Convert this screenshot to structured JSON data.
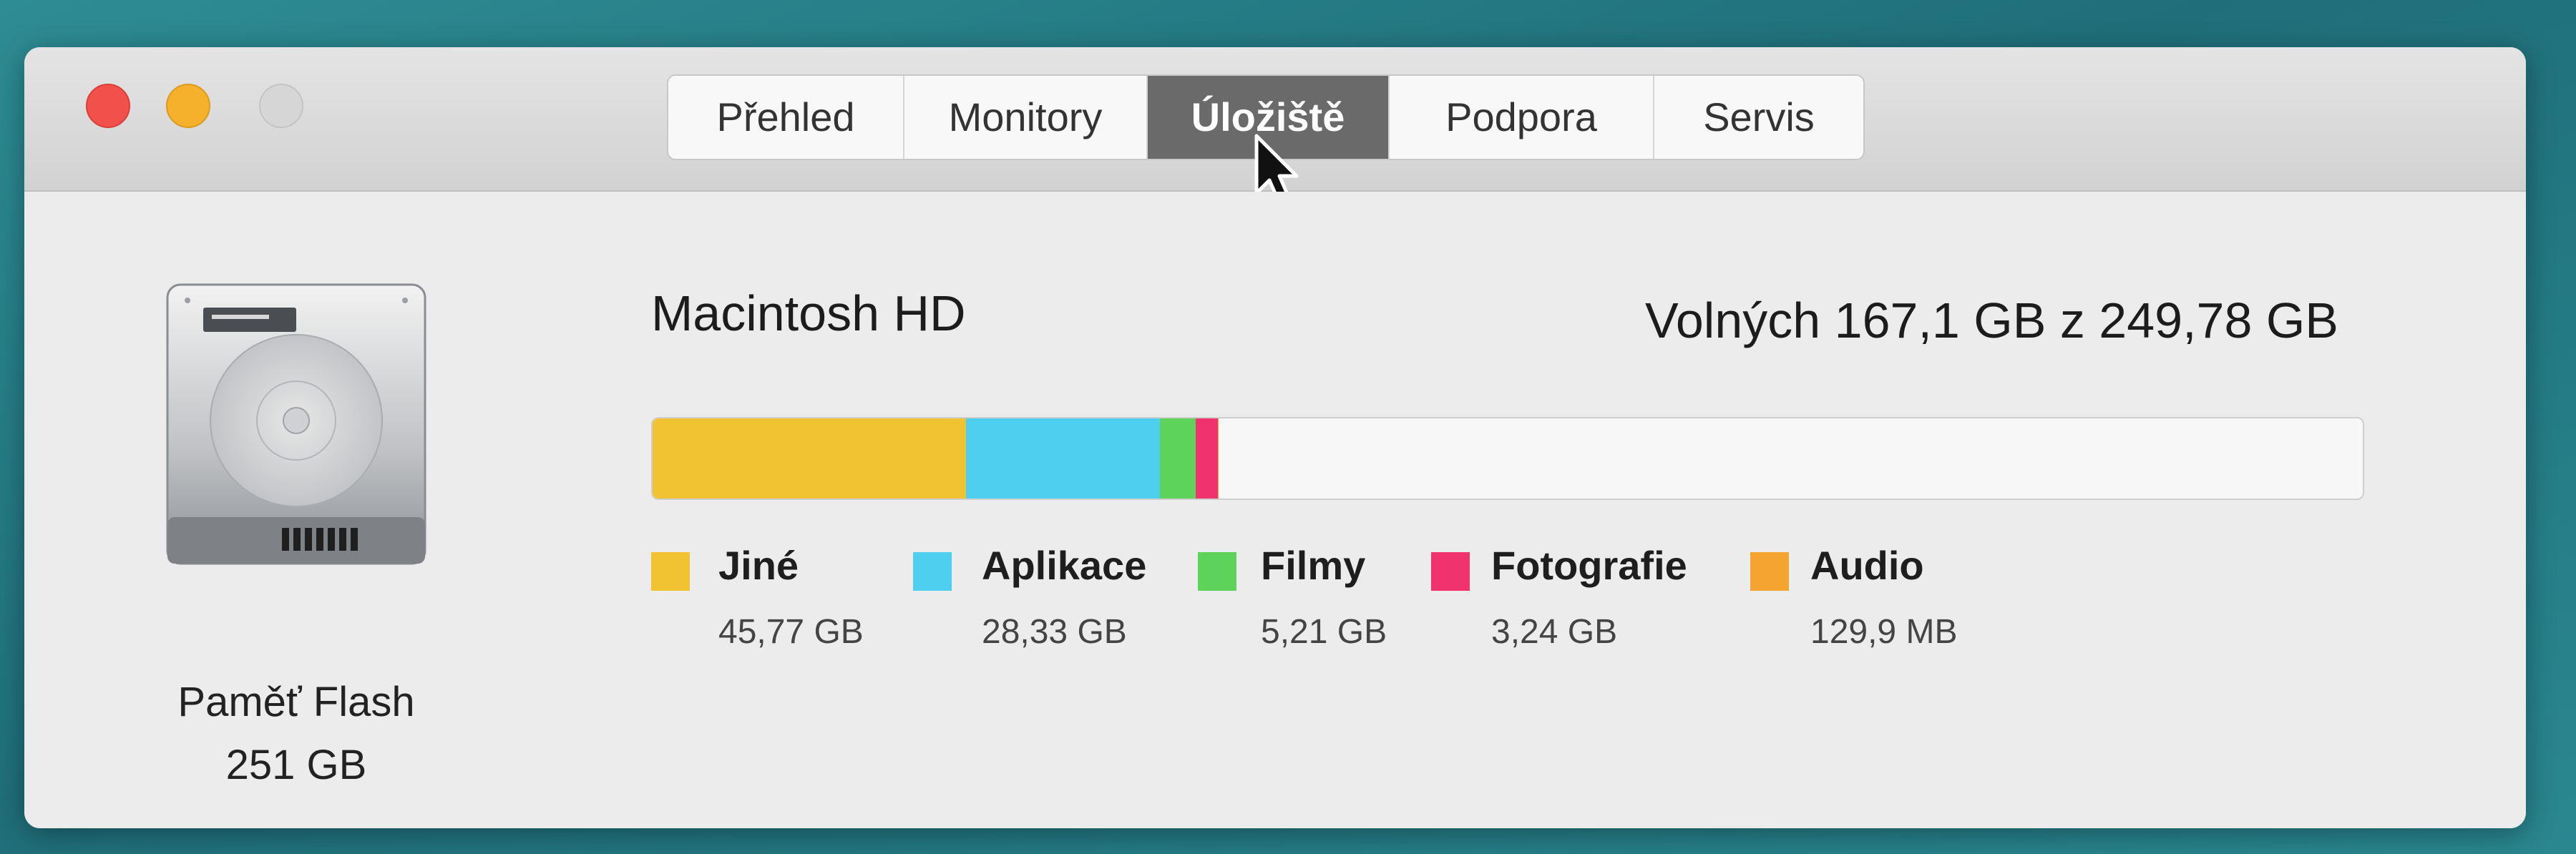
{
  "tabs": [
    {
      "label": "Přehled",
      "active": false
    },
    {
      "label": "Monitory",
      "active": false
    },
    {
      "label": "Úložiště",
      "active": true
    },
    {
      "label": "Podpora",
      "active": false
    },
    {
      "label": "Servis",
      "active": false
    }
  ],
  "disk": {
    "type_label": "Paměť Flash",
    "capacity_label": "251 GB",
    "icon": "hard-drive-icon"
  },
  "volume": {
    "name": "Macintosh HD",
    "free_label": "Volných 167,1 GB z 249,78 GB"
  },
  "storage": {
    "total_gb": 249.78,
    "categories": [
      {
        "name": "Jiné",
        "size_label": "45,77 GB",
        "gb": 45.77,
        "color": "#f1c232"
      },
      {
        "name": "Aplikace",
        "size_label": "28,33 GB",
        "gb": 28.33,
        "color": "#4fcff0"
      },
      {
        "name": "Filmy",
        "size_label": "5,21 GB",
        "gb": 5.21,
        "color": "#5ed35a"
      },
      {
        "name": "Fotografie",
        "size_label": "3,24 GB",
        "gb": 3.24,
        "color": "#f0336e"
      },
      {
        "name": "Audio",
        "size_label": "129,9 MB",
        "gb": 0.1299,
        "color": "#f5a431"
      }
    ]
  },
  "colors": {
    "window_bg": "#ececec",
    "active_tab": "#6a6a6a",
    "close": "#f2504a",
    "minimize": "#f5b02c",
    "zoom_disabled": "#d6d6d6"
  }
}
